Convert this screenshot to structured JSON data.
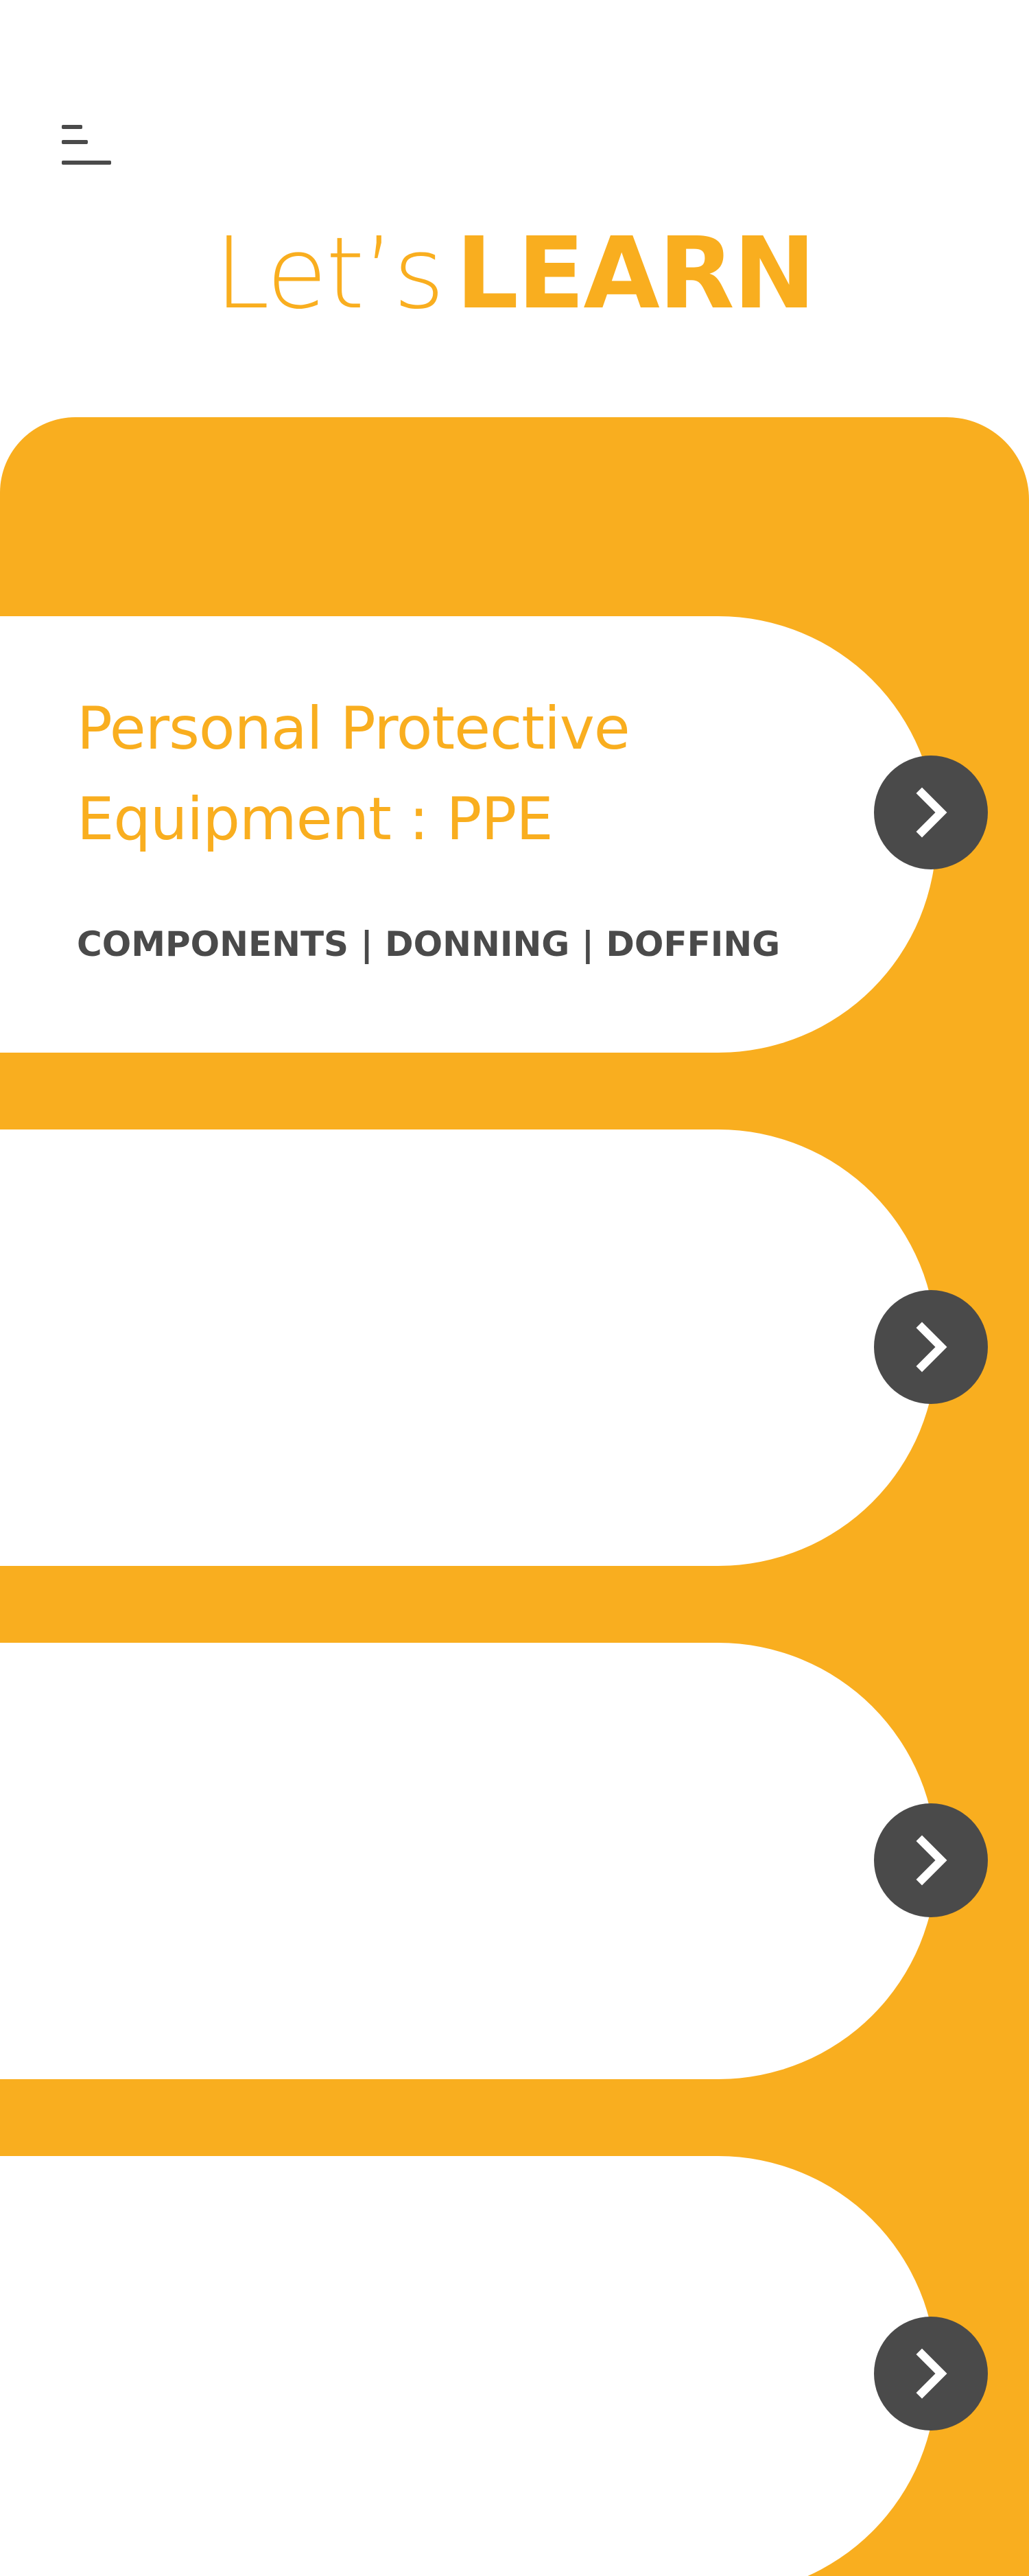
{
  "header": {
    "menu_icon": "hamburger-menu-icon",
    "title_light": "Let’s",
    "title_bold": "LEARN"
  },
  "colors": {
    "accent": "#f9ae1f",
    "dark": "#4a4a4a",
    "background": "#ffffff"
  },
  "cards": [
    {
      "title_line1": "Personal Protective",
      "title_line2": "Equipment :  PPE",
      "subtitle": "COMPONENTS | DONNING | DOFFING",
      "action_icon": "chevron-right-icon"
    },
    {
      "title_line1": "",
      "title_line2": "",
      "subtitle": "",
      "action_icon": "chevron-right-icon"
    },
    {
      "title_line1": "",
      "title_line2": "",
      "subtitle": "",
      "action_icon": "chevron-right-icon"
    },
    {
      "title_line1": "",
      "title_line2": "",
      "subtitle": "",
      "action_icon": "chevron-right-icon"
    }
  ]
}
